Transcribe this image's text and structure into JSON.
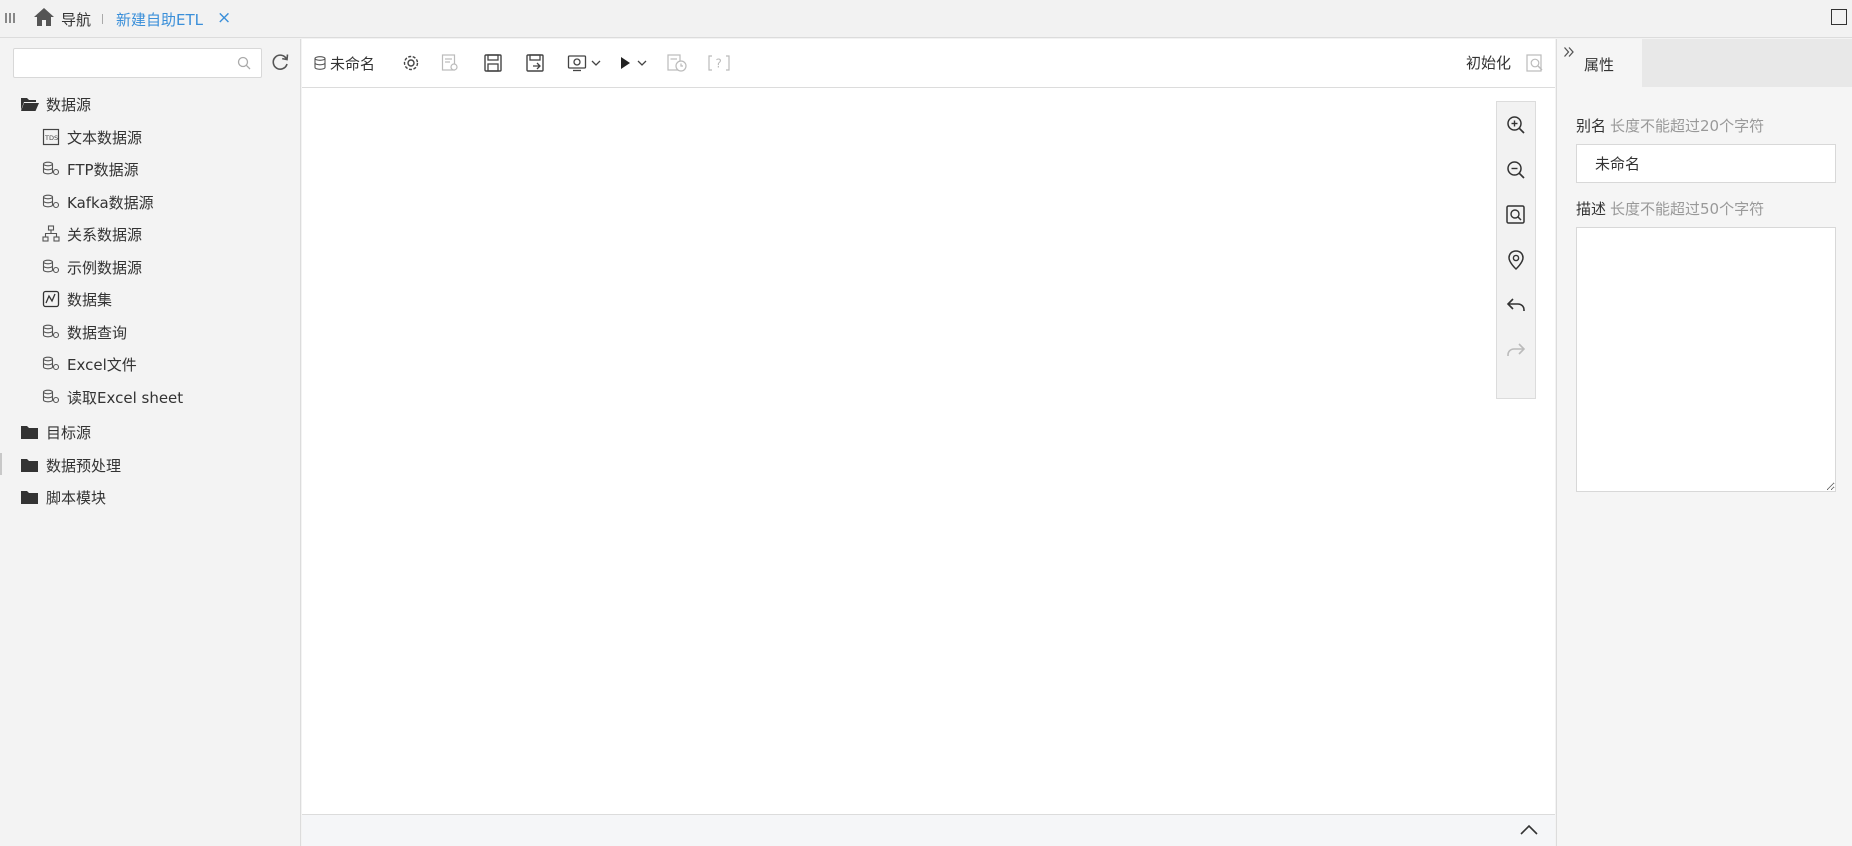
{
  "topbar": {
    "nav_label": "导航",
    "tab_label": "新建自助ETL",
    "close_symbol": "×"
  },
  "left": {
    "search": {
      "value": "",
      "placeholder": ""
    },
    "folders": [
      {
        "label": "数据源",
        "expanded": true
      },
      {
        "label": "目标源",
        "expanded": false
      },
      {
        "label": "数据预处理",
        "expanded": false
      },
      {
        "label": "脚本模块",
        "expanded": false
      }
    ],
    "datasource_items": [
      {
        "label": "文本数据源",
        "icon": "text-source-icon"
      },
      {
        "label": "FTP数据源",
        "icon": "database-link-icon"
      },
      {
        "label": "Kafka数据源",
        "icon": "database-link-icon"
      },
      {
        "label": "关系数据源",
        "icon": "relation-icon"
      },
      {
        "label": "示例数据源",
        "icon": "database-link-icon"
      },
      {
        "label": "数据集",
        "icon": "dataset-icon"
      },
      {
        "label": "数据查询",
        "icon": "database-link-icon"
      },
      {
        "label": "Excel文件",
        "icon": "database-link-icon"
      },
      {
        "label": "读取Excel sheet",
        "icon": "database-link-icon"
      }
    ]
  },
  "toolbar": {
    "name_label": "未命名",
    "init_label": "初始化"
  },
  "right": {
    "tab_label": "属性",
    "alias": {
      "label": "别名",
      "hint": "长度不能超过20个字符",
      "value": "未命名"
    },
    "desc": {
      "label": "描述",
      "hint": "长度不能超过50个字符",
      "value": ""
    }
  },
  "colors": {
    "accent": "#3a8fd9",
    "text": "#333333",
    "hint": "#999999",
    "border": "#dcdcdc",
    "panel_bg": "#f3f3f3"
  }
}
